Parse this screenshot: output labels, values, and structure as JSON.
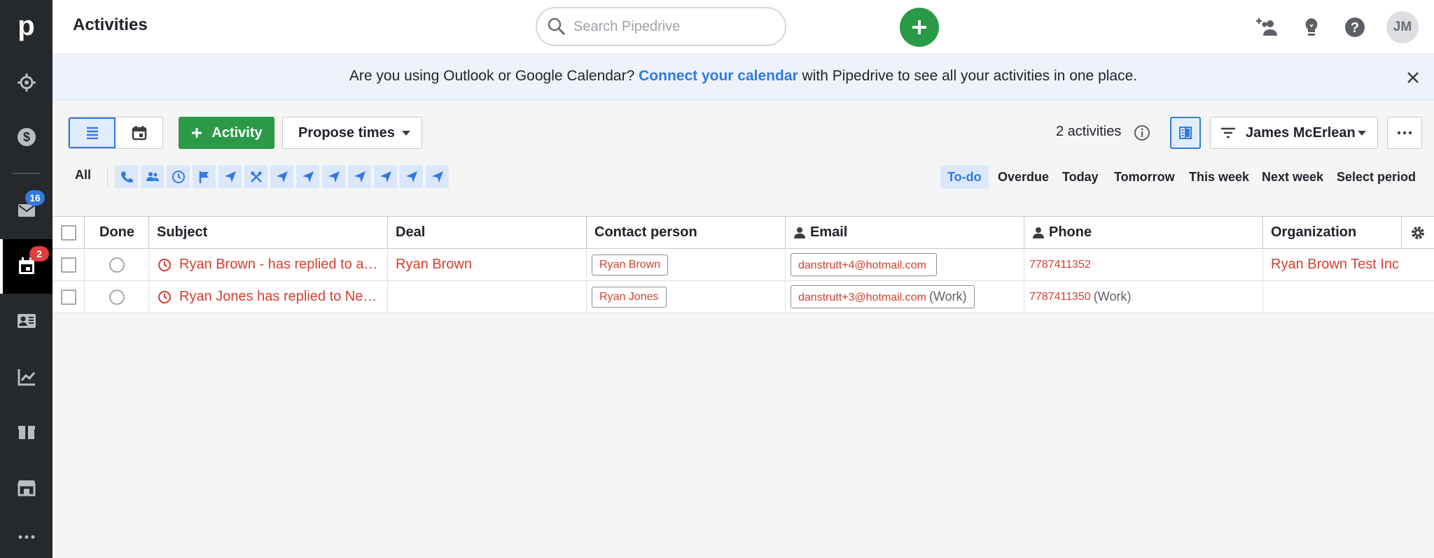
{
  "sidebar": {
    "logo": "p",
    "mail_badge": "16",
    "activities_badge": "2"
  },
  "header": {
    "title": "Activities",
    "search_placeholder": "Search Pipedrive",
    "avatar_initials": "JM"
  },
  "banner": {
    "text_before": "Are you using Outlook or Google Calendar? ",
    "link": "Connect your calendar",
    "text_after": " with Pipedrive to see all your activities in one place."
  },
  "toolbar": {
    "add_activity_label": "Activity",
    "propose_times_label": "Propose times",
    "activity_count": "2 activities",
    "filter_user": "James McErlean"
  },
  "type_filter": {
    "all_label": "All"
  },
  "periods": {
    "todo": "To-do",
    "overdue": "Overdue",
    "today": "Today",
    "tomorrow": "Tomorrow",
    "this_week": "This week",
    "next_week": "Next week",
    "select_period": "Select period"
  },
  "table": {
    "columns": {
      "done": "Done",
      "subject": "Subject",
      "deal": "Deal",
      "contact": "Contact person",
      "email": "Email",
      "phone": "Phone",
      "organization": "Organization"
    },
    "rows": [
      {
        "subject": "Ryan Brown -  has replied to a…",
        "deal": "Ryan Brown",
        "contact": "Ryan Brown",
        "email": "danstrutt+4@hotmail.com",
        "email_label": "",
        "phone": "7787411352",
        "phone_label": "",
        "organization": "Ryan Brown Test Inc"
      },
      {
        "subject": "Ryan Jones has replied to Ne…",
        "deal": "",
        "contact": "Ryan Jones",
        "email": "danstrutt+3@hotmail.com",
        "email_label": "(Work)",
        "phone": "7787411350",
        "phone_label": "(Work)",
        "organization": ""
      }
    ]
  },
  "colors": {
    "sidebar_bg": "#26292c",
    "accent_green": "#2b9a47",
    "accent_blue": "#317ae2",
    "overdue_red": "#d63e2f"
  }
}
